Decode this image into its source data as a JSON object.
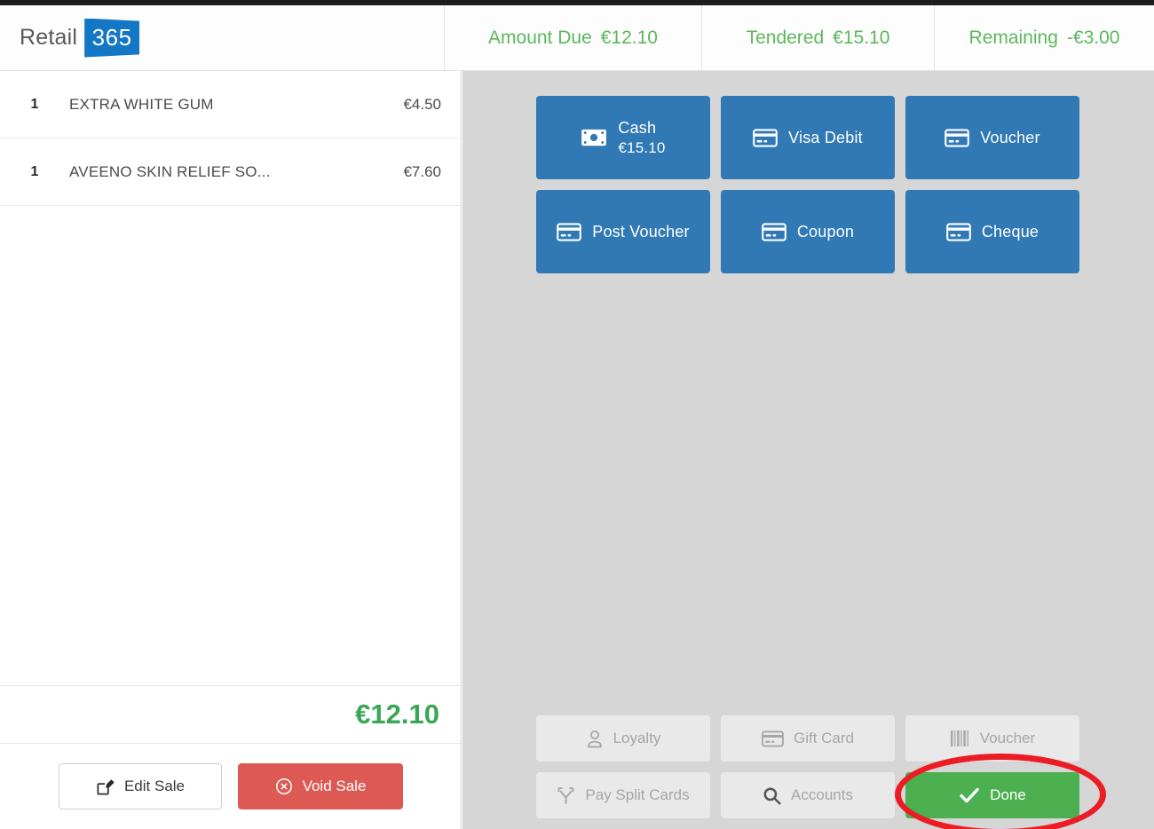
{
  "brand": {
    "name": "Retail",
    "badge": "365",
    "badge_color": "#1477c6"
  },
  "header": {
    "totals": [
      {
        "label": "Amount Due",
        "value": "€12.10"
      },
      {
        "label": "Tendered",
        "value": "€15.10"
      },
      {
        "label": "Remaining",
        "value": "-€3.00"
      }
    ],
    "total_color": "#5cb85c"
  },
  "sale": {
    "items": [
      {
        "qty": "1",
        "name": "EXTRA WHITE GUM",
        "price": "€4.50"
      },
      {
        "qty": "1",
        "name": "AVEENO SKIN RELIEF SO...",
        "price": "€7.60"
      }
    ],
    "total": "€12.10",
    "total_color": "#3aa757",
    "edit_label": "Edit Sale",
    "void_label": "Void Sale",
    "void_color": "#dd5a54"
  },
  "payments": {
    "accent_color": "#3079b5",
    "buttons": [
      {
        "label": "Cash",
        "sub": "€15.10",
        "icon": "banknote-icon"
      },
      {
        "label": "Visa Debit",
        "sub": "",
        "icon": "credit-card-icon"
      },
      {
        "label": "Voucher",
        "sub": "",
        "icon": "credit-card-icon"
      },
      {
        "label": "Post Voucher",
        "sub": "",
        "icon": "credit-card-icon"
      },
      {
        "label": "Coupon",
        "sub": "",
        "icon": "credit-card-icon"
      },
      {
        "label": "Cheque",
        "sub": "",
        "icon": "credit-card-icon"
      }
    ]
  },
  "functions": {
    "buttons": [
      {
        "label": "Loyalty",
        "icon": "person-icon",
        "state": "disabled"
      },
      {
        "label": "Gift Card",
        "icon": "credit-card-icon",
        "state": "disabled"
      },
      {
        "label": "Voucher",
        "icon": "barcode-icon",
        "state": "disabled"
      },
      {
        "label": "Pay Split Cards",
        "icon": "split-arrow-icon",
        "state": "disabled"
      },
      {
        "label": "Accounts",
        "icon": "magnifier-icon",
        "state": "disabled"
      },
      {
        "label": "Done",
        "icon": "check-icon",
        "state": "primary"
      }
    ],
    "done_color": "#4caf50"
  },
  "annotation": {
    "shape": "ellipse",
    "color": "#ec1c24",
    "targets": "Done"
  }
}
